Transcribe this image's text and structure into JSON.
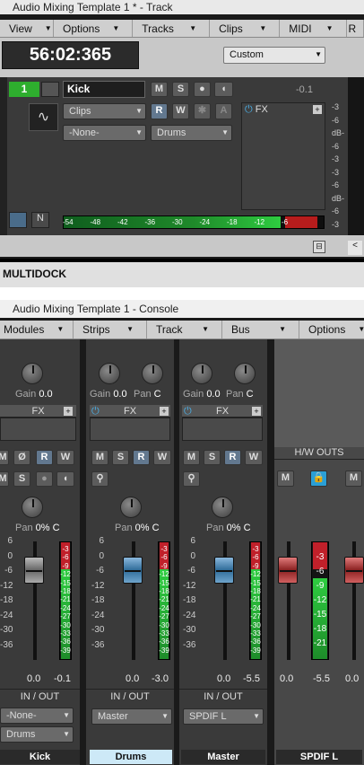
{
  "track_window": {
    "title": "Audio Mixing Template 1 * - Track",
    "menu": [
      "View",
      "Options",
      "Tracks",
      "Clips",
      "MIDI",
      "R"
    ],
    "time": "56:02:365",
    "preset": "Custom",
    "track_number": "1",
    "track_name": "Kick",
    "buttons": {
      "mute": "M",
      "solo": "S",
      "read": "R",
      "write": "W",
      "arm": "A"
    },
    "clips_label": "Clips",
    "input": "-None-",
    "output": "Drums",
    "volume": "-0.1",
    "fx_label": "FX",
    "meter_ticks": [
      "-54",
      "-48",
      "-42",
      "-36",
      "-30",
      "-24",
      "-18",
      "-12",
      "-6"
    ],
    "db_labels": [
      "-3",
      "-6",
      "dB-",
      "-6",
      "-3",
      "-3",
      "-6",
      "dB-",
      "-6",
      "-3"
    ]
  },
  "multidock": {
    "label": "MULTIDOCK"
  },
  "console_window": {
    "title": "Audio Mixing Template 1 - Console",
    "menu": [
      "Modules",
      "Strips",
      "Track",
      "Bus",
      "Options"
    ],
    "gain_label": "Gain",
    "pan_label": "Pan",
    "fx_label": "FX",
    "hw_outs": "H/W OUTS",
    "io_label": "IN / OUT",
    "scale": [
      "6",
      "0",
      "-6",
      "-12",
      "-18",
      "-24",
      "-30",
      "-36"
    ],
    "meter_marks": [
      "-3",
      "-6",
      "-9",
      "-12",
      "-15",
      "-18",
      "-21",
      "-24",
      "-27",
      "-30",
      "-33",
      "-36",
      "-39"
    ],
    "hw_meter_marks": [
      "-3",
      "-6",
      "-9",
      "-12",
      "-15",
      "-18",
      "-21"
    ],
    "strips": [
      {
        "name": "Kick",
        "gain": "0.0",
        "pan": "0% C",
        "fader": "0.0",
        "peak": "-0.1",
        "input": "-None-",
        "output": "Drums",
        "btn": [
          "M",
          "S",
          "R",
          "W"
        ]
      },
      {
        "name": "Drums",
        "gain": "0.0",
        "pan_knob": "C",
        "pan": "0% C",
        "fader": "0.0",
        "peak": "-3.0",
        "output": "Master",
        "btn": [
          "M",
          "S",
          "R",
          "W"
        ]
      },
      {
        "name": "Master",
        "gain": "0.0",
        "pan_knob": "C",
        "pan": "0% C",
        "fader": "0.0",
        "peak": "-5.5",
        "output": "SPDIF L",
        "btn": [
          "M",
          "S",
          "R",
          "W"
        ]
      },
      {
        "name": "SPDIF L",
        "fader": "0.0",
        "peak": "-5.5",
        "right_val": "0.0",
        "btn": [
          "M",
          "M"
        ]
      }
    ]
  }
}
